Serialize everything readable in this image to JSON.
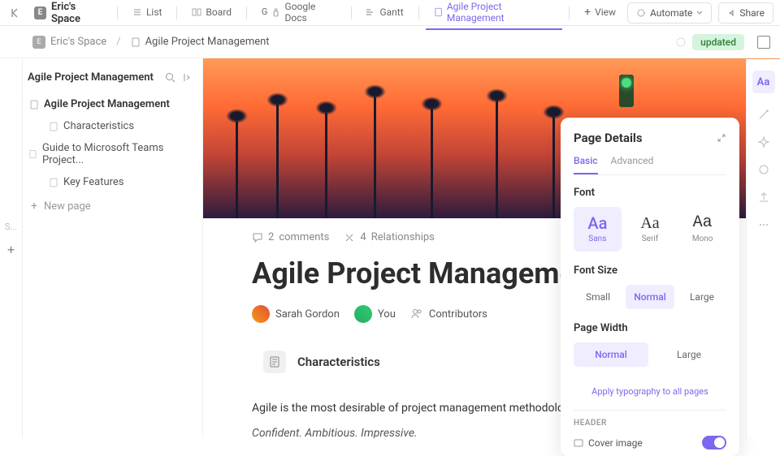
{
  "topbar": {
    "space_name": "Eric's Space",
    "tabs": [
      {
        "label": "List"
      },
      {
        "label": "Board"
      },
      {
        "label": "Google Docs"
      },
      {
        "label": "Gantt"
      },
      {
        "label": "Agile Project Management",
        "active": true
      }
    ],
    "view_label": "View",
    "automate": "Automate",
    "share": "Share"
  },
  "breadcrumb": {
    "space": "Eric's Space",
    "page": "Agile Project Management",
    "status": "updated"
  },
  "sidebar": {
    "title": "Agile Project Management",
    "items": [
      {
        "label": "Agile Project Management",
        "bold": true,
        "parent": true
      },
      {
        "label": "Characteristics",
        "child": true
      },
      {
        "label": "Guide to Microsoft Teams Project...",
        "parent": true
      },
      {
        "label": "Key Features",
        "child": true
      }
    ],
    "new_page": "New page"
  },
  "doc": {
    "comments_count": "2",
    "comments_label": "comments",
    "rel_count": "4",
    "rel_label": "Relationships",
    "title": "Agile Project Management",
    "authors": [
      {
        "name": "Sarah Gordon"
      },
      {
        "name": "You"
      }
    ],
    "contributors": "Contributors",
    "char_heading": "Characteristics",
    "body1": "Agile is the most desirable of project management methodology.",
    "body2": "Confident. Ambitious. Impressive."
  },
  "panel": {
    "title": "Page Details",
    "tabs": {
      "basic": "Basic",
      "advanced": "Advanced"
    },
    "font": {
      "label": "Font",
      "sans": "Sans",
      "serif": "Serif",
      "mono": "Mono",
      "aa": "Aa"
    },
    "size": {
      "label": "Font Size",
      "small": "Small",
      "normal": "Normal",
      "large": "Large"
    },
    "width": {
      "label": "Page Width",
      "normal": "Normal",
      "large": "Large"
    },
    "apply": "Apply typography to all pages",
    "header_label": "HEADER",
    "cover": "Cover image"
  },
  "rail": {
    "aa": "Aa"
  }
}
